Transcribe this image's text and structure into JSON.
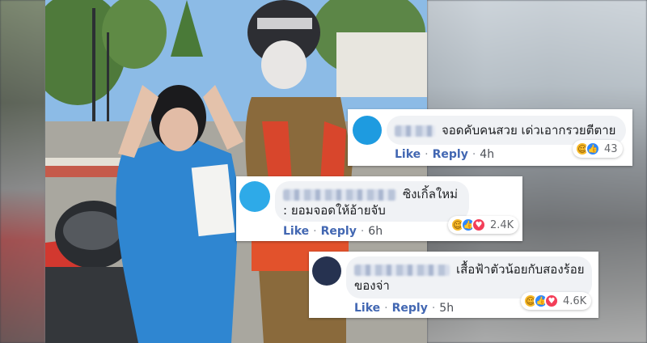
{
  "comments": [
    {
      "text": "จอดคับคนสวย เด่วเอากรวยตีตาย",
      "actions": {
        "like": "Like",
        "reply": "Reply",
        "time": "4h"
      },
      "reactions": {
        "icons": [
          "haha",
          "like"
        ],
        "count": "43"
      },
      "avatar_color": "#1e9be0"
    },
    {
      "text": "ซิงเกิ้ลใหม่ : ยอมจอดให้อ้ายจับ",
      "actions": {
        "like": "Like",
        "reply": "Reply",
        "time": "6h"
      },
      "reactions": {
        "icons": [
          "haha",
          "like",
          "love"
        ],
        "count": "2.4K"
      },
      "avatar_color": "#2eaae8"
    },
    {
      "text": "เสื้อฟ้าตัวน้อยกับสองร้อยของจ่า",
      "actions": {
        "like": "Like",
        "reply": "Reply",
        "time": "5h"
      },
      "reactions": {
        "icons": [
          "haha",
          "like",
          "love"
        ],
        "count": "4.6K"
      },
      "avatar_color": "#263250"
    }
  ],
  "colors": {
    "link": "#4267b2",
    "bubble": "#f0f2f5",
    "haha": "#f7b928",
    "like": "#2d88ff",
    "love": "#f33e58"
  }
}
